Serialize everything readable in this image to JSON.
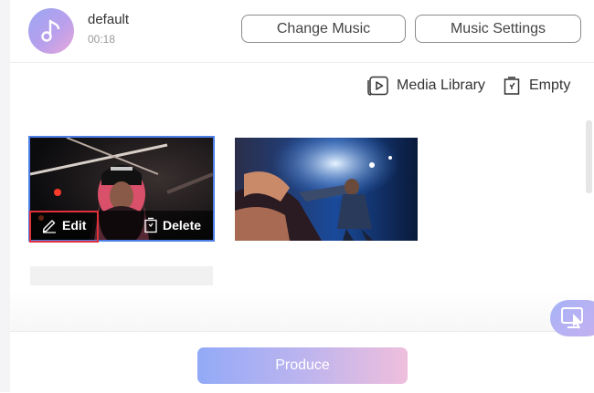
{
  "music": {
    "title": "default",
    "duration": "00:18",
    "icon": "music-note-icon"
  },
  "header": {
    "change_music_label": "Change Music",
    "music_settings_label": "Music Settings"
  },
  "toolbar": {
    "media_library_label": "Media Library",
    "media_library_icon": "play-box-icon",
    "empty_label": "Empty",
    "empty_icon": "trash-icon"
  },
  "clips": [
    {
      "thumbnail": "performer-pink-hair-cap",
      "selected": true,
      "edit_label": "Edit",
      "delete_label": "Delete"
    },
    {
      "thumbnail": "concert-hands-stage"
    }
  ],
  "footer": {
    "produce_label": "Produce"
  },
  "floating": {
    "icon": "screen-cursor-icon"
  },
  "colors": {
    "accent_gradient_start": "#93aaf7",
    "accent_gradient_end": "#efbfdc",
    "selection_border": "#4d7fe6",
    "highlight_red": "#e0303a"
  }
}
